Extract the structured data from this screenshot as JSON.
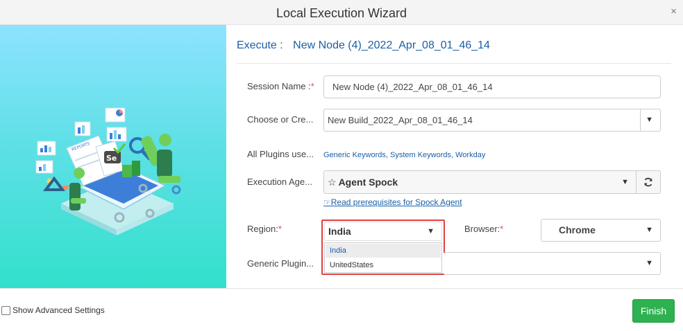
{
  "window": {
    "title": "Local Execution Wizard",
    "close_symbol": "×"
  },
  "execute": {
    "label": "Execute :",
    "value": "New Node (4)_2022_Apr_08_01_46_14"
  },
  "form": {
    "session_name": {
      "label": "Session Name :",
      "required_mark": "*",
      "value": "New Node (4)_2022_Apr_08_01_46_14"
    },
    "build": {
      "label": "Choose or Cre...",
      "value": "New Build_2022_Apr_08_01_46_14"
    },
    "plugins": {
      "label": "All Plugins use...",
      "value": "Generic Keywords, System Keywords, Workday"
    },
    "agent": {
      "label": "Execution Age...",
      "value": "Agent Spock",
      "star_symbol": "☆",
      "link": "Read prerequisites for Spock Agent",
      "link_icon_symbol": "☞"
    },
    "region": {
      "label": "Region:",
      "required_mark": "*",
      "value": "India",
      "options": [
        "India",
        "UnitedStates"
      ]
    },
    "browser": {
      "label": "Browser:",
      "required_mark": "*",
      "value": "Chrome"
    },
    "generic_plugin": {
      "label": "Generic Plugin...",
      "value": ""
    }
  },
  "footer": {
    "advanced_label": "Show Advanced Settings",
    "finish_label": "Finish"
  },
  "icons": {
    "close": "close-icon",
    "caret": "caret-down-icon",
    "refresh": "refresh-icon",
    "star": "star-icon",
    "link": "hand-pointer-icon",
    "checkbox": "checkbox-icon"
  },
  "colors": {
    "accent_blue": "#1a5fa6",
    "finish_green": "#2eb150",
    "required_red": "#d9534f",
    "highlight_red": "#e04040",
    "illus_top": "#8ee3ff",
    "illus_bottom": "#33e0cc"
  }
}
